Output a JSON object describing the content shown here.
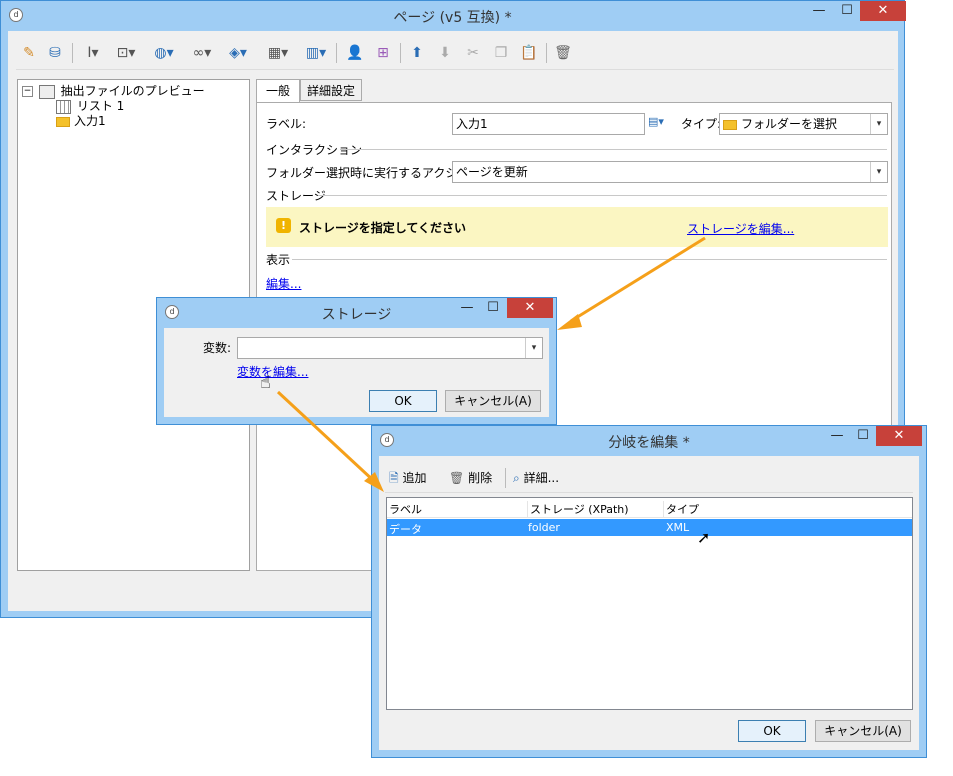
{
  "main_window": {
    "title": "ページ (v5 互換) *",
    "controls": {
      "minimize": "—",
      "maximize": "☐",
      "close": "✕"
    },
    "tree": {
      "root": "抽出ファイルのプレビュー",
      "children": [
        "リスト 1",
        "入力1"
      ]
    },
    "tabs": [
      "一般",
      "詳細設定"
    ],
    "label_caption": "ラベル:",
    "label_value": "入力1",
    "type_caption": "タイプ:",
    "type_value": "フォルダーを選択",
    "interaction_section": "インタラクション",
    "action_caption": "フォルダー選択時に実行するアクション:",
    "action_value": "ページを更新",
    "storage_section": "ストレージ",
    "warning_text": "ストレージを指定してください",
    "edit_storage_link": "ストレージを編集...",
    "display_section": "表示",
    "edit_link": "編集..."
  },
  "storage_dialog": {
    "title": "ストレージ",
    "variable_caption": "変数:",
    "variable_value": "",
    "edit_variable_link": "変数を編集...",
    "ok": "OK",
    "cancel": "キャンセル(A)"
  },
  "fork_dialog": {
    "title": "分岐を編集 *",
    "toolbar": {
      "add": "追加",
      "delete": "削除",
      "details": "詳細..."
    },
    "columns": [
      "ラベル",
      "ストレージ (XPath)",
      "タイプ"
    ],
    "rows": [
      {
        "label": "データ",
        "storage": "folder",
        "type": "XML"
      }
    ],
    "ok": "OK",
    "cancel": "キャンセル(A)"
  },
  "colors": {
    "accent_orange": "#f5a01a",
    "warning_bg": "#fbf6c2",
    "selection": "#3399ff",
    "title_bg": "#9fcdf4"
  }
}
